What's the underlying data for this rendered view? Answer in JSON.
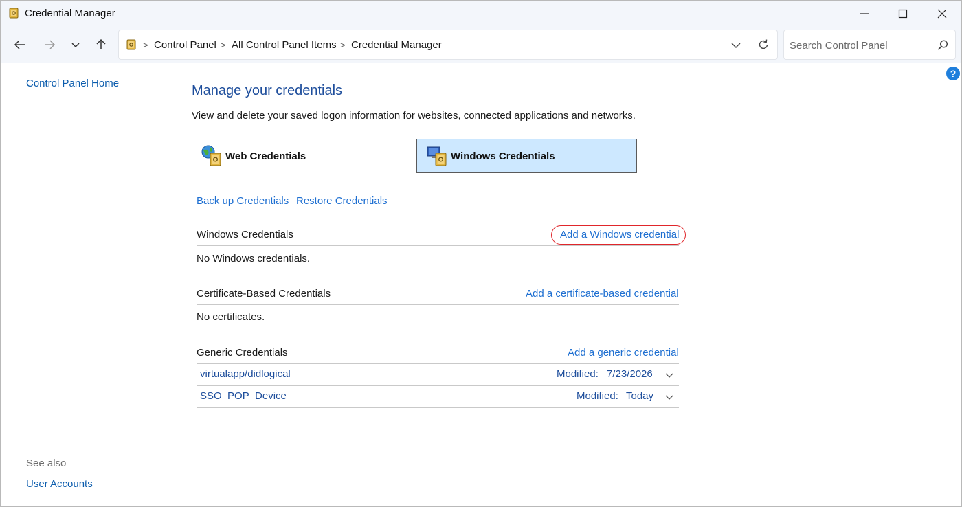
{
  "window": {
    "title": "Credential Manager"
  },
  "breadcrumb": {
    "items": [
      "Control Panel",
      "All Control Panel Items",
      "Credential Manager"
    ],
    "separator": ">"
  },
  "search": {
    "placeholder": "Search Control Panel"
  },
  "help": {
    "label": "?"
  },
  "left_nav": {
    "home_link": "Control Panel Home",
    "see_also_label": "See also",
    "see_also_links": [
      "User Accounts"
    ]
  },
  "main": {
    "title": "Manage your credentials",
    "description": "View and delete your saved logon information for websites, connected applications and networks.",
    "tabs": [
      {
        "label": "Web Credentials",
        "selected": false
      },
      {
        "label": "Windows Credentials",
        "selected": true
      }
    ],
    "backup_link": "Back up Credentials",
    "restore_link": "Restore Credentials",
    "sections": [
      {
        "heading": "Windows Credentials",
        "action_link": "Add a Windows credential",
        "empty_text": "No Windows credentials."
      },
      {
        "heading": "Certificate-Based Credentials",
        "action_link": "Add a certificate-based credential",
        "empty_text": "No certificates."
      },
      {
        "heading": "Generic Credentials",
        "action_link": "Add a generic credential",
        "items": [
          {
            "name": "virtualapp/didlogical",
            "modified_label": "Modified:",
            "modified_value": "7/23/2026"
          },
          {
            "name": "SSO_POP_Device",
            "modified_label": "Modified:",
            "modified_value": "Today"
          }
        ]
      }
    ]
  },
  "colors": {
    "link_blue": "#1e6fd1",
    "title_blue": "#1e4e9c",
    "selected_tab_bg": "#cde8ff",
    "highlight_ring": "#e0262b",
    "chrome_bg": "#f3f6fb"
  }
}
